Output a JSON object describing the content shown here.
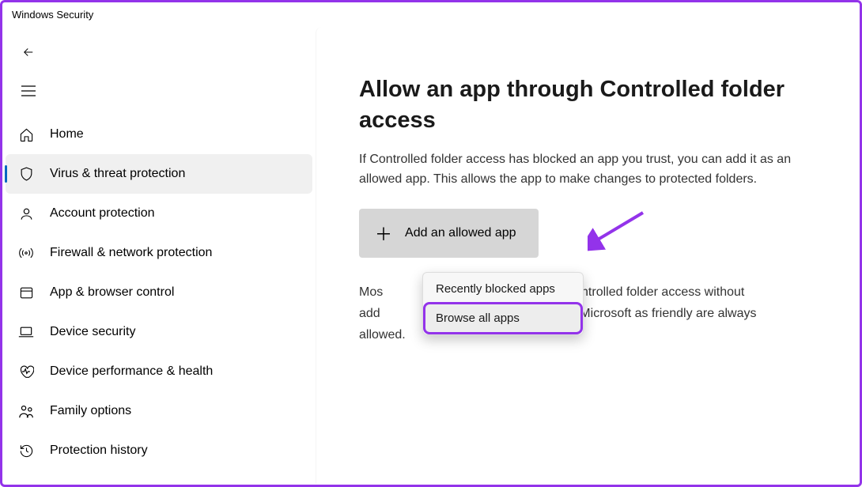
{
  "app_title": "Windows Security",
  "sidebar": {
    "items": [
      {
        "icon": "home",
        "label": "Home"
      },
      {
        "icon": "shield",
        "label": "Virus & threat protection",
        "selected": true
      },
      {
        "icon": "person",
        "label": "Account protection"
      },
      {
        "icon": "firewall",
        "label": "Firewall & network protection"
      },
      {
        "icon": "browser",
        "label": "App & browser control"
      },
      {
        "icon": "laptop",
        "label": "Device security"
      },
      {
        "icon": "heart",
        "label": "Device performance & health"
      },
      {
        "icon": "family",
        "label": "Family options"
      },
      {
        "icon": "history",
        "label": "Protection history"
      }
    ]
  },
  "main": {
    "title": "Allow an app through Controlled folder access",
    "description": "If Controlled folder access has blocked an app you trust, you can add it as an allowed app. This allows the app to make changes to protected folders.",
    "add_button_label": "Add an allowed app",
    "body_text": "Most of your apps will be allowed by Controlled folder access without adding them here. Apps determined by Microsoft as friendly are always allowed.",
    "body_text_pre": "Mos",
    "body_text_mid1": "wed by Controlled folder access without",
    "body_text_mid2_pre": "add",
    "body_text_mid2": "rmined by Microsoft as friendly are always",
    "body_text_last": "allowed."
  },
  "dropdown": {
    "items": [
      {
        "label": "Recently blocked apps"
      },
      {
        "label": "Browse all apps",
        "annotated": true
      }
    ]
  },
  "annotation": {
    "arrow_color": "#9333ea"
  }
}
